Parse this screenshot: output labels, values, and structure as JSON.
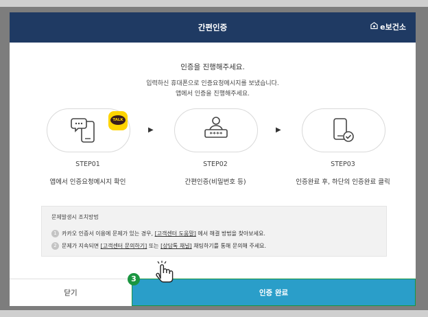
{
  "modal": {
    "title": "간편인증",
    "brand": "e보건소"
  },
  "intro": {
    "line1": "인증을 진행해주세요.",
    "line2": "입력하신 휴대폰으로 인증요청메시지를 보냈습니다.",
    "line3": "앱에서 인증을 진행해주세요."
  },
  "steps": [
    {
      "id": "STEP01",
      "desc": "앱에서 인증요청메시지 확인",
      "icon": "phone-message-icon",
      "badge": "TALK"
    },
    {
      "id": "STEP02",
      "desc": "간편인증(비밀번호 등)",
      "icon": "password-user-icon",
      "password_mask": "****"
    },
    {
      "id": "STEP03",
      "desc": "인증완료 후, 하단의 인증완료 클릭",
      "icon": "phone-check-icon"
    }
  ],
  "help": {
    "title": "문제발생시 조치방법",
    "row1": {
      "num": "1",
      "pre": "카카오 인증서 이용에 문제가 있는 경우, ",
      "link": "[고객센터 도움말]",
      "post": " 에서 해결 방법을 찾아보세요."
    },
    "row2": {
      "num": "2",
      "pre": "문제가 지속되면 ",
      "link1": "[고객센터 문의하기]",
      "mid": " 또는 ",
      "link2": "[상담톡 채널]",
      "post": " 채팅하기를 통해 문의해 주세요."
    }
  },
  "footer": {
    "close_label": "닫기",
    "done_label": "인증 완료"
  },
  "annotation": {
    "step_number": "3"
  }
}
